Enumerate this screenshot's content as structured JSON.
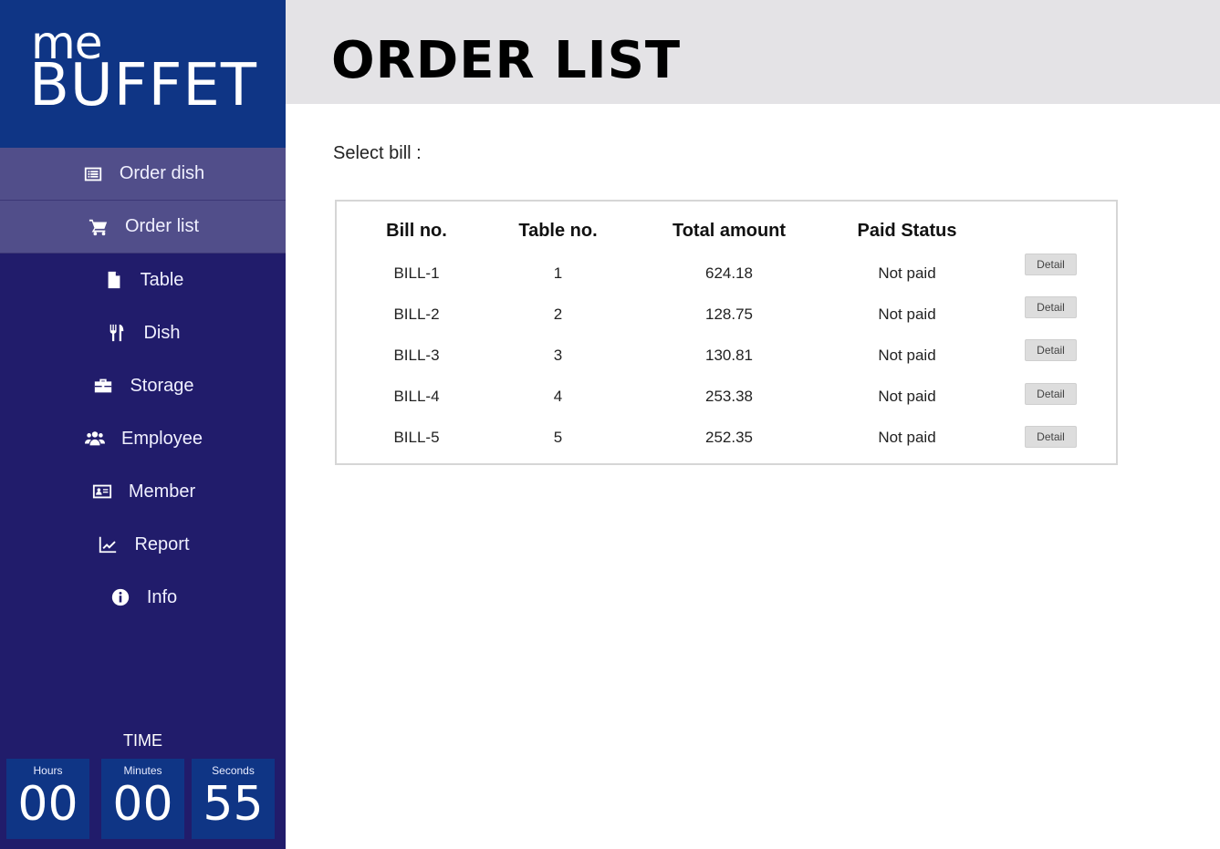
{
  "brand": {
    "logo_top": "me",
    "logo_bottom": "BUFFET"
  },
  "sidebar": {
    "items": [
      {
        "label": "Order dish",
        "icon": "list-icon"
      },
      {
        "label": "Order list",
        "icon": "cart-icon"
      },
      {
        "label": "Table",
        "icon": "document-icon"
      },
      {
        "label": "Dish",
        "icon": "utensils-icon"
      },
      {
        "label": "Storage",
        "icon": "briefcase-icon"
      },
      {
        "label": "Employee",
        "icon": "group-icon"
      },
      {
        "label": "Member",
        "icon": "id-card-icon"
      },
      {
        "label": "Report",
        "icon": "line-chart-icon"
      },
      {
        "label": "Info",
        "icon": "info-icon"
      }
    ]
  },
  "timer": {
    "title": "TIME",
    "hours_label": "Hours",
    "hours": "00",
    "minutes_label": "Minutes",
    "minutes": "00",
    "seconds_label": "Seconds",
    "seconds": "55"
  },
  "header": {
    "title": "ORDER LIST"
  },
  "main": {
    "select_label": "Select bill :",
    "columns": [
      "Bill no.",
      "Table no.",
      "Total amount",
      "Paid Status"
    ],
    "rows": [
      {
        "bill": "BILL-1",
        "table": "1",
        "total": "624.18",
        "status": "Not paid",
        "action": "Detail"
      },
      {
        "bill": "BILL-2",
        "table": "2",
        "total": "128.75",
        "status": "Not paid",
        "action": "Detail"
      },
      {
        "bill": "BILL-3",
        "table": "3",
        "total": "130.81",
        "status": "Not paid",
        "action": "Detail"
      },
      {
        "bill": "BILL-4",
        "table": "4",
        "total": "253.38",
        "status": "Not paid",
        "action": "Detail"
      },
      {
        "bill": "BILL-5",
        "table": "5",
        "total": "252.35",
        "status": "Not paid",
        "action": "Detail"
      }
    ]
  },
  "colors": {
    "sidebar": "#211c6b",
    "brand": "#0f3585",
    "highlight": "#514e8a",
    "header": "#e4e3e6"
  }
}
